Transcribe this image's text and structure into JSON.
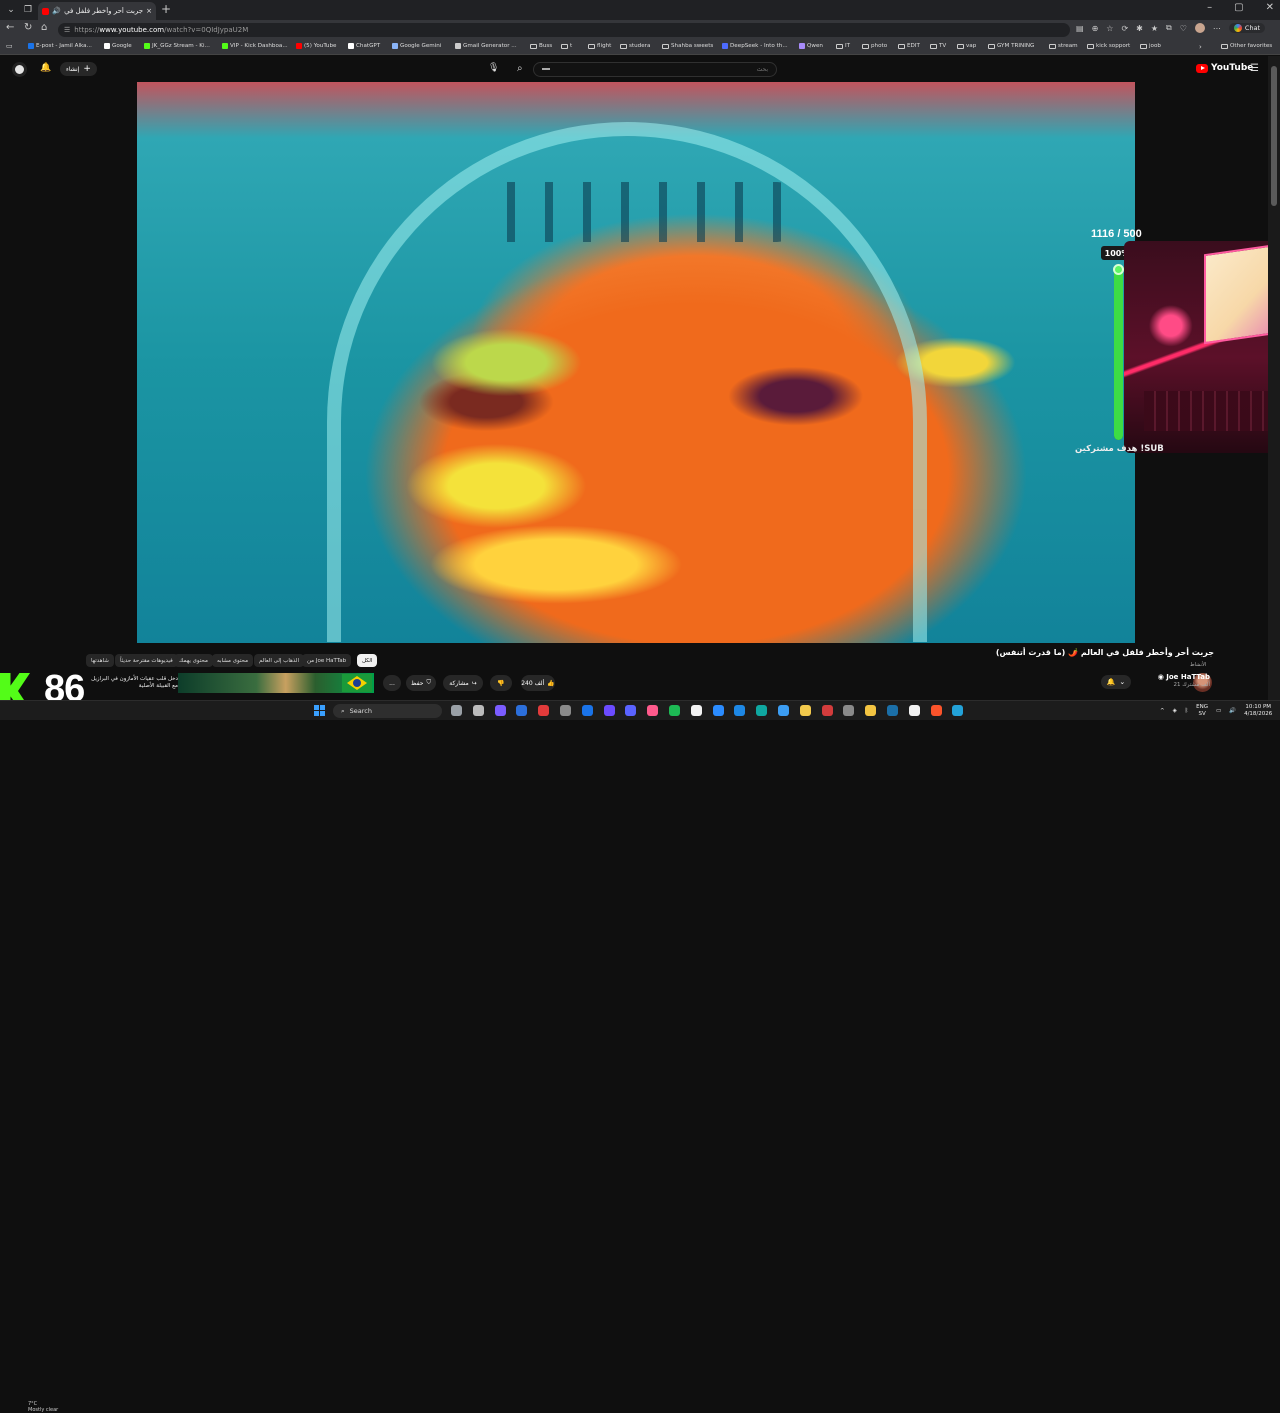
{
  "browser": {
    "tab_title": "جربت أحر وأخطر فلفل في العا...",
    "url_prefix": "https://",
    "url_host": "www.youtube.com",
    "url_path": "/watch?v=0QIdJypaU2M",
    "chat_label": "Chat",
    "bookmarks": [
      {
        "label": "E-post - Jamil Alka...",
        "color": "#1a73e8",
        "type": "icon"
      },
      {
        "label": "Google",
        "color": "#ffffff",
        "type": "icon"
      },
      {
        "label": "JK_GGz Stream - Ki...",
        "color": "#53fc18",
        "type": "icon"
      },
      {
        "label": "VIP - Kick Dashboa...",
        "color": "#53fc18",
        "type": "icon"
      },
      {
        "label": "(5) YouTube",
        "color": "#ff0000",
        "type": "icon"
      },
      {
        "label": "ChatGPT",
        "color": "#ffffff",
        "type": "icon"
      },
      {
        "label": "Google Gemini",
        "color": "#8ab4f8",
        "type": "icon"
      },
      {
        "label": "Gmail Generator ...",
        "color": "#cccccc",
        "type": "icon"
      },
      {
        "label": "Buss",
        "type": "folder"
      },
      {
        "label": "t",
        "type": "folder"
      },
      {
        "label": "flight",
        "type": "folder"
      },
      {
        "label": "studera",
        "type": "folder"
      },
      {
        "label": "Shahba sweets",
        "type": "folder"
      },
      {
        "label": "DeepSeek - Into th...",
        "color": "#4d6bfe",
        "type": "icon"
      },
      {
        "label": "Qwen",
        "color": "#a78bfa",
        "type": "icon"
      },
      {
        "label": "IT",
        "type": "folder"
      },
      {
        "label": "photo",
        "type": "folder"
      },
      {
        "label": "EDIT",
        "type": "folder"
      },
      {
        "label": "TV",
        "type": "folder"
      },
      {
        "label": "vap",
        "type": "folder"
      },
      {
        "label": "GYM TRINING",
        "type": "folder"
      },
      {
        "label": "stream",
        "type": "folder"
      },
      {
        "label": "kick sopport",
        "type": "folder"
      },
      {
        "label": "joob",
        "type": "folder"
      }
    ],
    "other_favorites": "Other favorites"
  },
  "youtube": {
    "logo_text": "YouTube",
    "search_placeholder": "بحث",
    "create_label": "إنشاء",
    "video_title": "جربت أحر وأخطر فلفل في العالم 🌶️ (ما قدرت أتنفس)",
    "channel_name": "Joe HaTTab",
    "channel_subs": "21 ألف مشترك",
    "channel_badge": "الأنشاط",
    "like_count": "240 ألف",
    "share_label": "مشاركة",
    "save_label": "حفظ",
    "more_label": "...",
    "chips": [
      "الكل",
      "من Joe HaTTab",
      "الذهاب إلى العالم",
      "محتوى مشابه",
      "محتوى يهمك",
      "فيديوهات مقترحة حديثاً",
      "شاهدتها"
    ],
    "suggestion_title": "دخل قلب عقيات الأمازون في البرازيل مع القبيلة الأصلية"
  },
  "overlay": {
    "sub_counter": "1116 / 500",
    "sub_percent": "100%",
    "progress_fraction": 1.0,
    "sub_goal": "هدف مشتركين !SUB",
    "viewer_count": "86",
    "weather_temp": "7°C",
    "weather_desc": "Mostly clear"
  },
  "taskbar": {
    "search_label": "Search",
    "lang_top": "ENG",
    "lang_bottom": "SV",
    "time": "10:10 PM",
    "date": "4/18/2026"
  }
}
